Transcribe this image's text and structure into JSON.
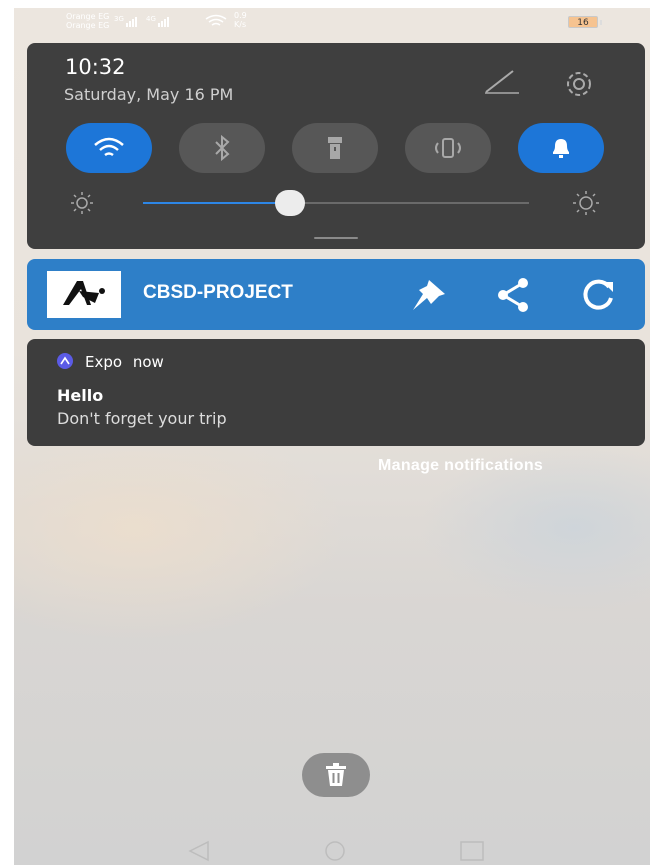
{
  "status_bar": {
    "carrier_1": "Orange EG",
    "carrier_2": "Orange EG",
    "net_type_1": "3G",
    "net_type_2": "4G",
    "speed_value": "0.9",
    "speed_unit": "K/s",
    "battery": "16"
  },
  "quick_settings": {
    "time": "10:32",
    "date": "Saturday, May 16  PM",
    "toggles": [
      {
        "name": "wifi",
        "icon": "wifi-icon",
        "state": "on"
      },
      {
        "name": "bluetooth",
        "icon": "bluetooth-icon",
        "state": "off"
      },
      {
        "name": "flashlight",
        "icon": "flashlight-icon",
        "state": "off"
      },
      {
        "name": "vibrate",
        "icon": "vibrate-icon",
        "state": "off"
      },
      {
        "name": "sound",
        "icon": "bell-icon",
        "state": "on"
      }
    ],
    "brightness_level": 0.38
  },
  "app_notification": {
    "title": "CBSD-PROJECT",
    "actions": [
      "pin-icon",
      "share-icon",
      "refresh-icon"
    ]
  },
  "expo_notification": {
    "app": "Expo",
    "time": "now",
    "title": "Hello",
    "body": "Don't forget your trip"
  },
  "manage_notifications": "Manage notifications",
  "colors": {
    "accent": "#1d76d8",
    "app_notification_bg": "#2e7fc8",
    "panel_bg": "#3f3f3f"
  }
}
